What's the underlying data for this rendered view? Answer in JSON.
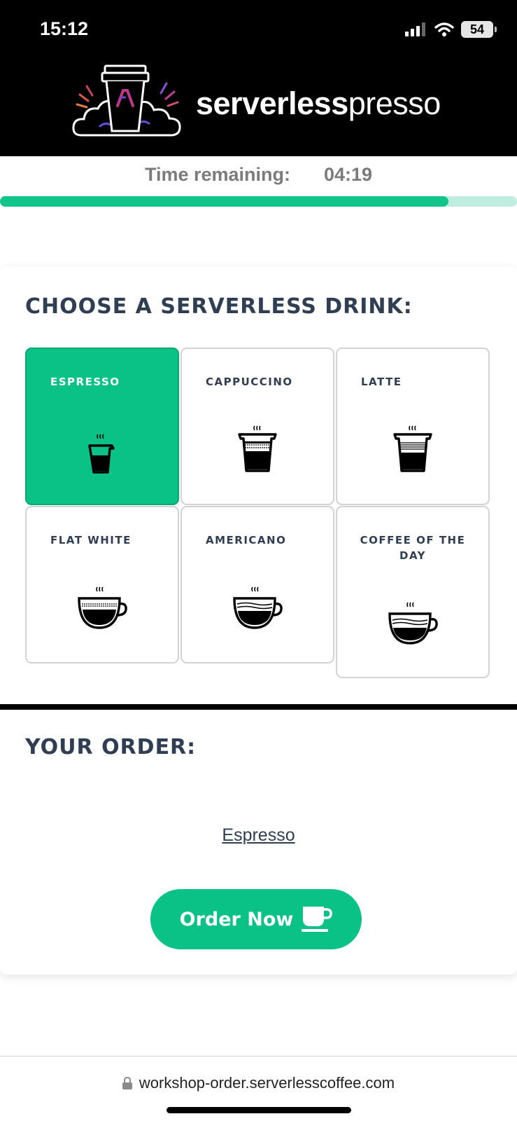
{
  "status_bar": {
    "time": "15:12",
    "battery": "54"
  },
  "brand": {
    "bold": "serverless",
    "light": "presso"
  },
  "timer": {
    "label": "Time remaining:",
    "value": "04:19",
    "progress_fraction": 0.867
  },
  "menu": {
    "title": "CHOOSE A SERVERLESS DRINK:",
    "drinks": [
      {
        "label": "ESPRESSO",
        "icon": "espresso-cup-icon",
        "selected": true
      },
      {
        "label": "CAPPUCCINO",
        "icon": "cappuccino-cup-icon",
        "selected": false
      },
      {
        "label": "LATTE",
        "icon": "latte-cup-icon",
        "selected": false
      },
      {
        "label": "FLAT WHITE",
        "icon": "flat-white-cup-icon",
        "selected": false
      },
      {
        "label": "AMERICANO",
        "icon": "americano-cup-icon",
        "selected": false
      },
      {
        "label": "COFFEE OF THE DAY",
        "icon": "coffee-of-the-day-cup-icon",
        "selected": false
      }
    ]
  },
  "order": {
    "title": "YOUR ORDER:",
    "item": "Espresso",
    "button_label": "Order Now",
    "button_icon": "coffee-cup-icon"
  },
  "browser": {
    "url": "workshop-order.serverlesscoffee.com"
  },
  "colors": {
    "accent": "#0ac186",
    "header_bg": "#000000",
    "heading_text": "#2f3e52",
    "progress_track": "#bfeee0"
  }
}
